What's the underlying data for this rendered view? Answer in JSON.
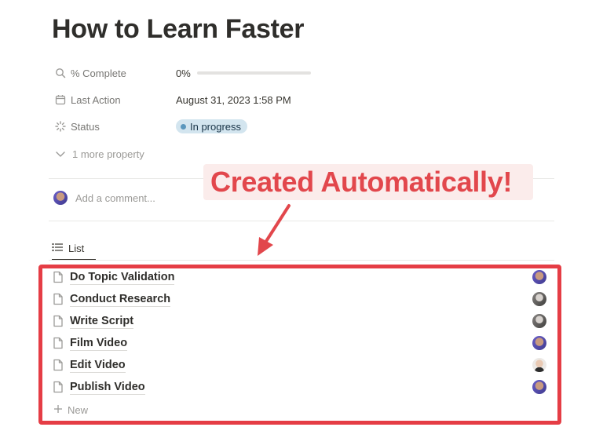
{
  "page": {
    "title": "How to Learn Faster"
  },
  "properties": {
    "complete": {
      "name": "% Complete",
      "value": "0%",
      "progress_fraction": 0,
      "icon": "search-icon"
    },
    "last_action": {
      "name": "Last Action",
      "value": "August 31, 2023 1:58 PM",
      "icon": "calendar-icon"
    },
    "status": {
      "name": "Status",
      "value": "In progress",
      "icon": "status-spinner-icon",
      "badge_color": "#d3e5ef",
      "dot_color": "#5b97bd"
    },
    "more": {
      "label": "1 more property",
      "icon": "chevron-down-icon"
    }
  },
  "comment": {
    "placeholder": "Add a comment..."
  },
  "callout": {
    "text": "Created Automatically!",
    "text_color": "#e2474c",
    "background": "#fbeceb"
  },
  "view_tab": {
    "label": "List",
    "icon": "list-icon"
  },
  "list": {
    "items": [
      {
        "label": "Do Topic Validation",
        "assignee_avatar": "avatar-a"
      },
      {
        "label": "Conduct Research",
        "assignee_avatar": "avatar-b"
      },
      {
        "label": "Write Script",
        "assignee_avatar": "avatar-b"
      },
      {
        "label": "Film Video",
        "assignee_avatar": "avatar-a"
      },
      {
        "label": "Edit Video",
        "assignee_avatar": "avatar-c"
      },
      {
        "label": "Publish Video",
        "assignee_avatar": "avatar-a"
      }
    ],
    "new_label": "New",
    "highlight_color": "#e53d45"
  }
}
